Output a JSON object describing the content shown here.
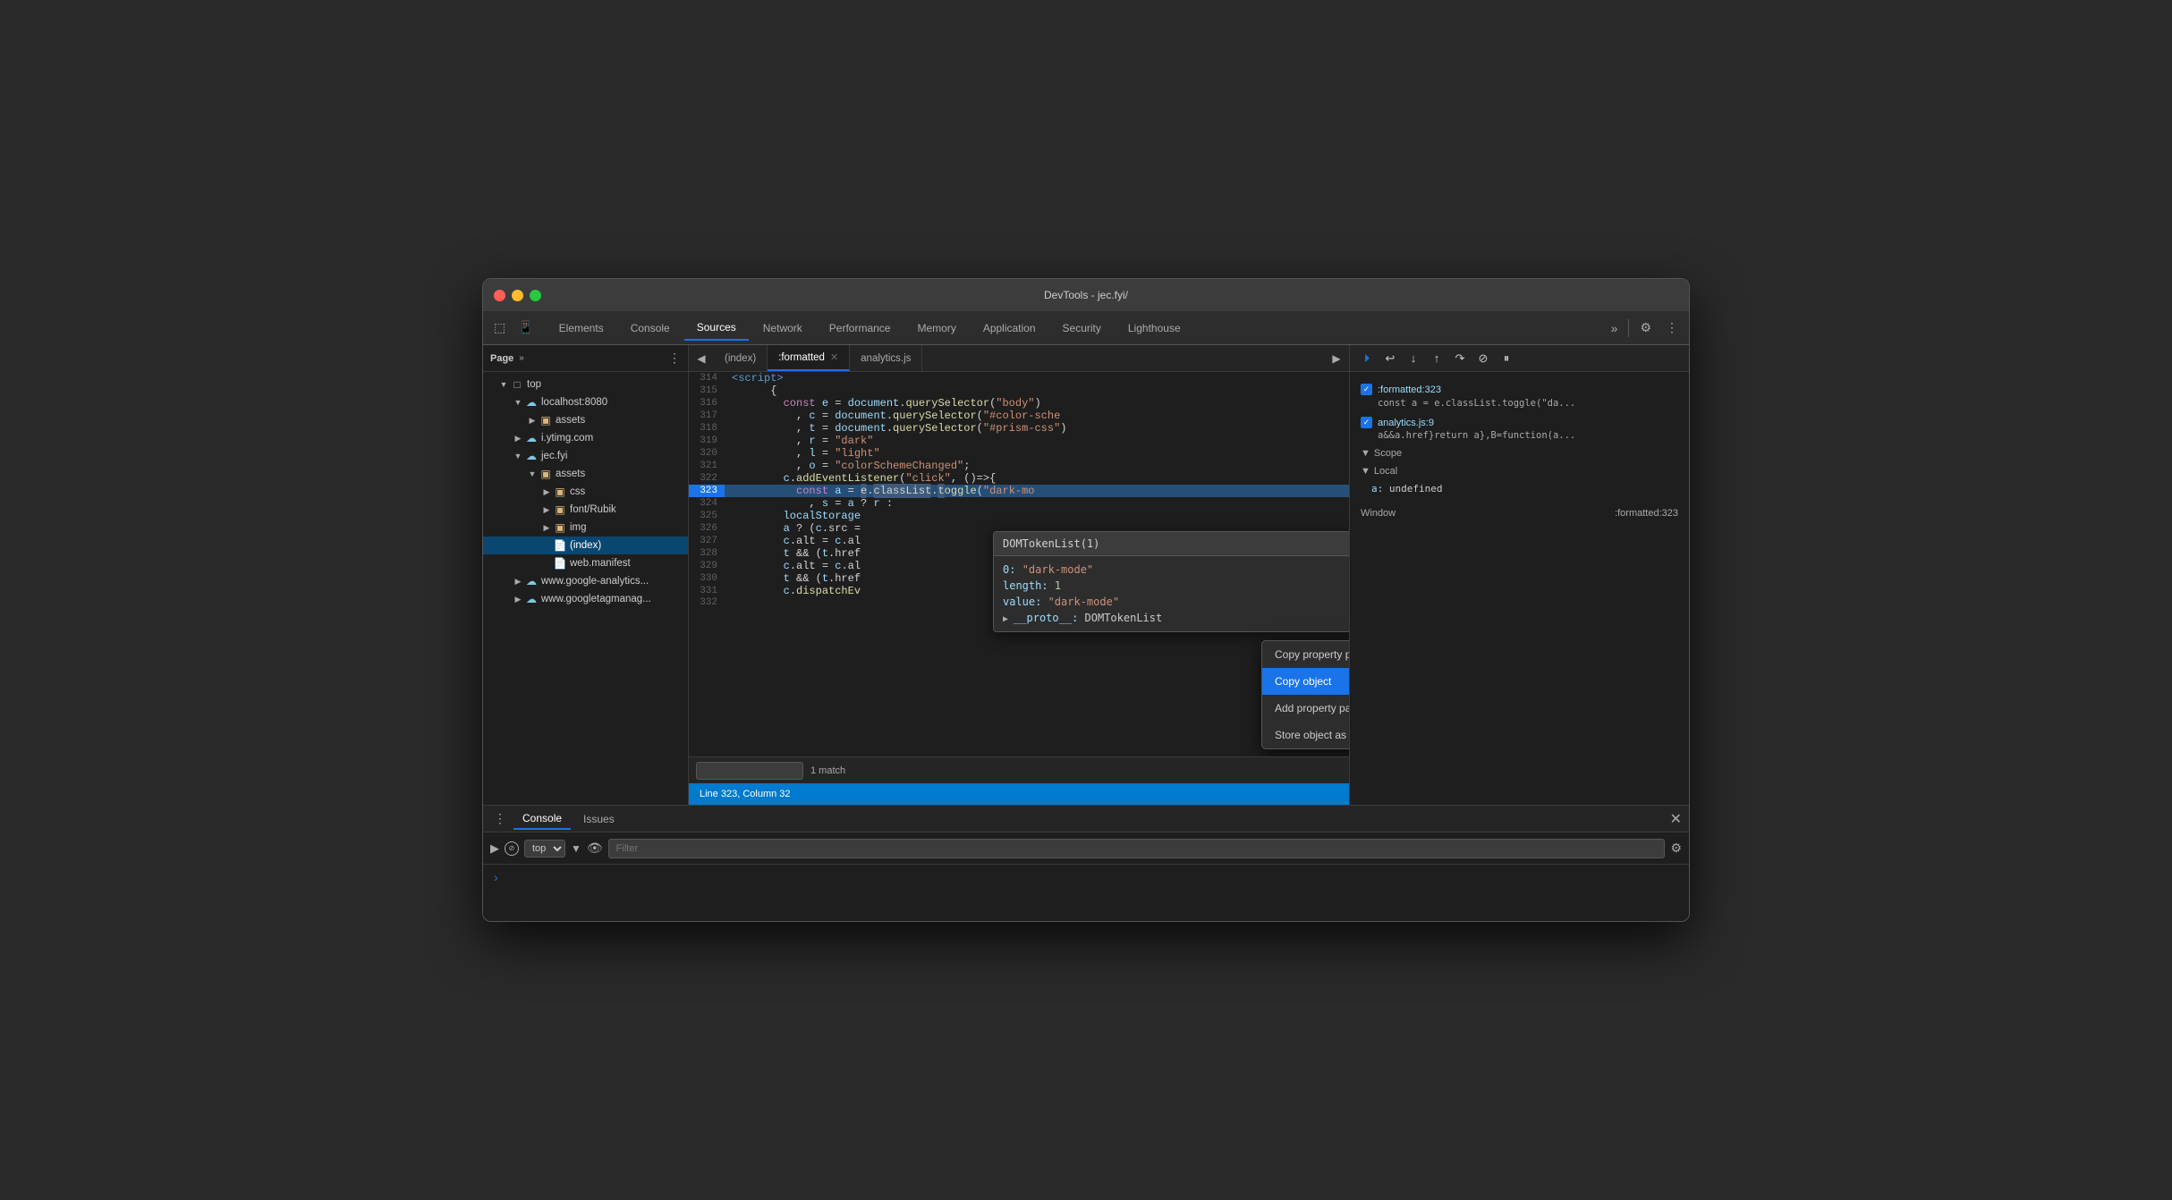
{
  "window": {
    "title": "DevTools - jec.fyi/",
    "traffic_lights": [
      "red",
      "yellow",
      "green"
    ]
  },
  "topbar": {
    "tabs": [
      {
        "label": "Elements",
        "active": false
      },
      {
        "label": "Console",
        "active": false
      },
      {
        "label": "Sources",
        "active": true
      },
      {
        "label": "Network",
        "active": false
      },
      {
        "label": "Performance",
        "active": false
      },
      {
        "label": "Memory",
        "active": false
      },
      {
        "label": "Application",
        "active": false
      },
      {
        "label": "Security",
        "active": false
      },
      {
        "label": "Lighthouse",
        "active": false
      }
    ]
  },
  "file_tree": {
    "header": "Page",
    "items": [
      {
        "label": "top",
        "type": "arrow-folder",
        "depth": 0,
        "expanded": true
      },
      {
        "label": "localhost:8080",
        "type": "cloud-folder",
        "depth": 1,
        "expanded": true
      },
      {
        "label": "assets",
        "type": "folder",
        "depth": 2,
        "expanded": false
      },
      {
        "label": "i.ytimg.com",
        "type": "cloud-folder",
        "depth": 1,
        "expanded": false
      },
      {
        "label": "jec.fyi",
        "type": "cloud-folder",
        "depth": 1,
        "expanded": true
      },
      {
        "label": "assets",
        "type": "folder",
        "depth": 2,
        "expanded": true
      },
      {
        "label": "css",
        "type": "folder",
        "depth": 3,
        "expanded": false
      },
      {
        "label": "font/Rubik",
        "type": "folder",
        "depth": 3,
        "expanded": false
      },
      {
        "label": "img",
        "type": "folder",
        "depth": 3,
        "expanded": false
      },
      {
        "label": "(index)",
        "type": "file",
        "depth": 3,
        "selected": true
      },
      {
        "label": "web.manifest",
        "type": "file",
        "depth": 3
      },
      {
        "label": "www.google-analytics...",
        "type": "cloud-folder",
        "depth": 1,
        "expanded": false
      },
      {
        "label": "www.googletagmanag...",
        "type": "cloud-folder",
        "depth": 1,
        "expanded": false
      }
    ]
  },
  "editor": {
    "tabs": [
      {
        "label": "(index)",
        "active": false
      },
      {
        "label": ":formatted",
        "active": true,
        "closeable": true
      },
      {
        "label": "analytics.js",
        "active": false
      }
    ],
    "lines": [
      {
        "num": 314,
        "code": "    <script>"
      },
      {
        "num": 315,
        "code": "      {"
      },
      {
        "num": 316,
        "code": "        const e = document.querySelector(\"body\")"
      },
      {
        "num": 317,
        "code": "          , c = document.querySelector(\"#color-sche"
      },
      {
        "num": 318,
        "code": "          , t = document.querySelector(\"#prism-css\")"
      },
      {
        "num": 319,
        "code": "          , r = \"dark\""
      },
      {
        "num": 320,
        "code": "          , l = \"light\""
      },
      {
        "num": 321,
        "code": "          , o = \"colorSchemeChanged\";"
      },
      {
        "num": 322,
        "code": "        c.addEventListener(\"click\", ()=>{"
      },
      {
        "num": 323,
        "code": "          const a = e.classList.toggle(\"dark-mo",
        "highlighted": true
      },
      {
        "num": 324,
        "code": "            , s = a ? r : "
      },
      {
        "num": 325,
        "code": "        localStorage"
      },
      {
        "num": 326,
        "code": "        a ? (c.src ="
      },
      {
        "num": 327,
        "code": "        c.alt = c.al"
      },
      {
        "num": 328,
        "code": "        t && (t.href"
      },
      {
        "num": 329,
        "code": "        c.alt = c.al"
      },
      {
        "num": 330,
        "code": "        t && (t.href"
      },
      {
        "num": 331,
        "code": "        c.dispatchEv"
      },
      {
        "num": 332,
        "code": ""
      }
    ],
    "status": {
      "line": 323,
      "col": 32,
      "text": "Line 323, Column 32"
    },
    "search": {
      "value": "",
      "match_count": "1 match"
    }
  },
  "tooltip": {
    "title": "DOMTokenList(1)",
    "rows": [
      {
        "key": "0:",
        "val": "\"dark-mode\""
      },
      {
        "key": "length:",
        "val": "1",
        "type": "number"
      },
      {
        "key": "value:",
        "val": "\"dark-mode\""
      },
      {
        "key": "▶ __proto__:",
        "val": "DOMTokenList"
      }
    ]
  },
  "context_menu": {
    "items": [
      {
        "label": "Copy property path",
        "selected": false
      },
      {
        "label": "Copy object",
        "selected": true
      },
      {
        "label": "Add property path to watch",
        "selected": false
      },
      {
        "label": "Store object as global variable",
        "selected": false
      }
    ]
  },
  "debugger": {
    "breakpoints": [
      {
        "file": ":formatted:323",
        "code": "const a = e.classList.toggle(\"da..."
      },
      {
        "file": "analytics.js:9",
        "code": "a&&a.href}return a},B=function(a..."
      }
    ],
    "scope": {
      "title": "Scope",
      "local_title": "Local",
      "items": [
        {
          "key": "a:",
          "val": "undefined"
        }
      ]
    },
    "call_stack": {
      "title": "Window",
      "location": ":formatted:323"
    }
  },
  "console": {
    "tabs": [
      {
        "label": "Console",
        "active": true
      },
      {
        "label": "Issues",
        "active": false
      }
    ],
    "top_selector": "top",
    "filter_placeholder": "Filter"
  }
}
